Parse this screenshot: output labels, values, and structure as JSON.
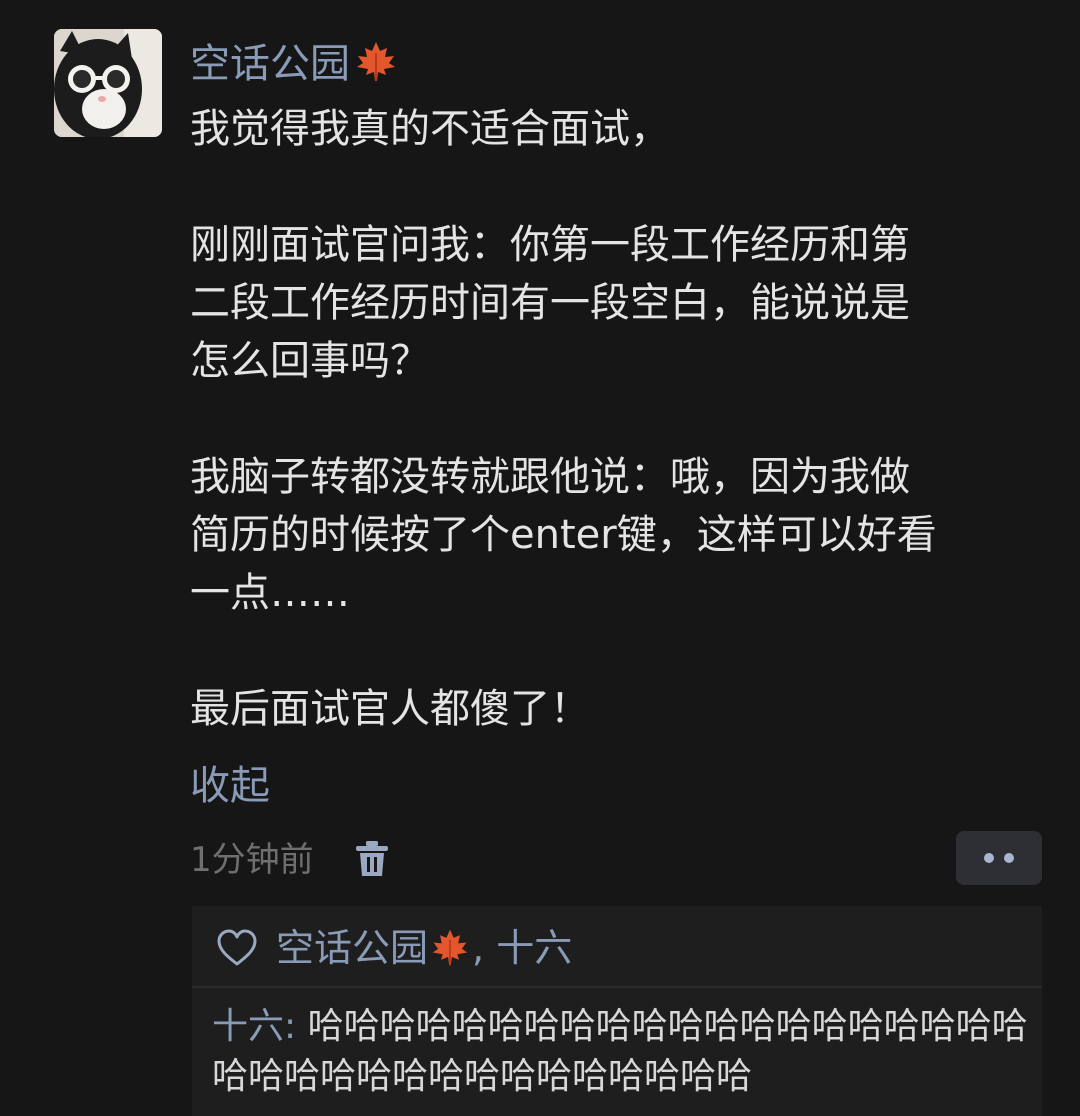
{
  "post": {
    "author": "空话公园",
    "author_badge_icon": "maple-leaf-icon",
    "paragraphs": [
      "我觉得我真的不适合面试，",
      "刚刚面试官问我：你第一段工作经历和第\n二段工作经历时间有一段空白，能说说是\n怎么回事吗？",
      "我脑子转都没转就跟他说：哦，因为我做\n简历的时候按了个enter键，这样可以好看\n一点……",
      "最后面试官人都傻了！"
    ],
    "collapse_label": "收起",
    "timestamp": "1分钟前"
  },
  "likes": {
    "icon": "heart-icon",
    "liker_1": "空话公园",
    "separator": ",",
    "liker_2": "十六"
  },
  "comment": {
    "author": "十六",
    "separator": ": ",
    "text": "哈哈哈哈哈哈哈哈哈哈哈哈哈哈哈哈哈哈哈哈哈哈哈哈哈哈哈哈哈哈哈哈哈哈哈"
  },
  "colors": {
    "background": "#161616",
    "name_blue": "#8a9bb8",
    "maple_leaf": "#e2572b"
  }
}
